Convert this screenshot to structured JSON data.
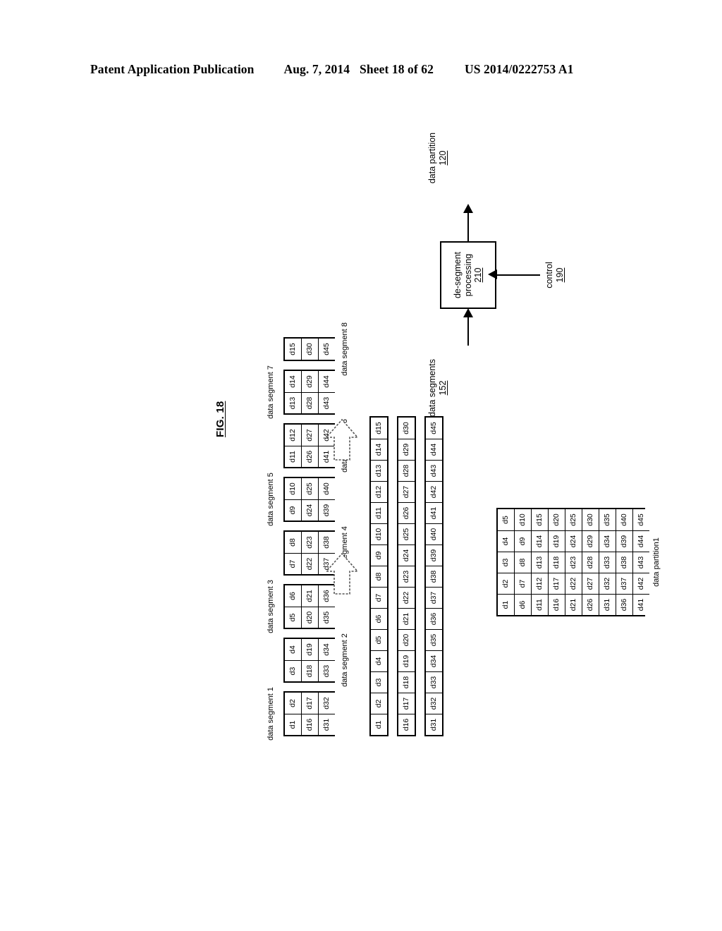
{
  "header": {
    "publication": "Patent Application Publication",
    "date": "Aug. 7, 2014",
    "sheet": "Sheet 18 of 62",
    "number": "US 2014/0222753 A1"
  },
  "figure": {
    "label": "FIG. 18"
  },
  "segments_group": {
    "segments": [
      {
        "label": "data segment 1",
        "label_side": "start",
        "rows": [
          [
            "d1",
            "d2"
          ],
          [
            "d16",
            "d17"
          ],
          [
            "d31",
            "d32"
          ]
        ]
      },
      {
        "label": "data segment 2",
        "label_side": "end",
        "rows": [
          [
            "d3",
            "d4"
          ],
          [
            "d18",
            "d19"
          ],
          [
            "d33",
            "d34"
          ]
        ]
      },
      {
        "label": "data segment 3",
        "label_side": "start",
        "rows": [
          [
            "d5",
            "d6"
          ],
          [
            "d20",
            "d21"
          ],
          [
            "d35",
            "d36"
          ]
        ]
      },
      {
        "label": "data segment 4",
        "label_side": "end",
        "rows": [
          [
            "d7",
            "d8"
          ],
          [
            "d22",
            "d23"
          ],
          [
            "d37",
            "d38"
          ]
        ]
      },
      {
        "label": "data segment 5",
        "label_side": "start",
        "rows": [
          [
            "d9",
            "d10"
          ],
          [
            "d24",
            "d25"
          ],
          [
            "d39",
            "d40"
          ]
        ]
      },
      {
        "label": "data segment 6",
        "label_side": "end",
        "rows": [
          [
            "d11",
            "d12"
          ],
          [
            "d26",
            "d27"
          ],
          [
            "d41",
            "d42"
          ]
        ]
      },
      {
        "label": "data segment 7",
        "label_side": "start",
        "rows": [
          [
            "d13",
            "d14"
          ],
          [
            "d28",
            "d29"
          ],
          [
            "d43",
            "d44"
          ]
        ]
      },
      {
        "label": "data segment 8",
        "label_side": "end",
        "rows": [
          [
            "d15"
          ],
          [
            "d30"
          ],
          [
            "d45"
          ]
        ]
      }
    ]
  },
  "strips_group": {
    "strips": [
      [
        "d1",
        "d2",
        "d3",
        "d4",
        "d5",
        "d6",
        "d7",
        "d8",
        "d9",
        "d10",
        "d11",
        "d12",
        "d13",
        "d14",
        "d15"
      ],
      [
        "d16",
        "d17",
        "d18",
        "d19",
        "d20",
        "d21",
        "d22",
        "d23",
        "d24",
        "d25",
        "d26",
        "d27",
        "d28",
        "d29",
        "d30"
      ],
      [
        "d31",
        "d32",
        "d33",
        "d34",
        "d35",
        "d36",
        "d37",
        "d38",
        "d39",
        "d40",
        "d41",
        "d42",
        "d43",
        "d44",
        "d45"
      ]
    ]
  },
  "partition": {
    "label": "data partition1",
    "rows": [
      [
        "d1",
        "d2",
        "d3",
        "d4",
        "d5"
      ],
      [
        "d6",
        "d7",
        "d8",
        "d9",
        "d10"
      ],
      [
        "d11",
        "d12",
        "d13",
        "d14",
        "d15"
      ],
      [
        "d16",
        "d17",
        "d18",
        "d19",
        "d20"
      ],
      [
        "d21",
        "d22",
        "d23",
        "d24",
        "d25"
      ],
      [
        "d26",
        "d27",
        "d28",
        "d29",
        "d30"
      ],
      [
        "d31",
        "d32",
        "d33",
        "d34",
        "d35"
      ],
      [
        "d36",
        "d37",
        "d38",
        "d39",
        "d40"
      ],
      [
        "d41",
        "d42",
        "d43",
        "d44",
        "d45"
      ]
    ]
  },
  "process_flow": {
    "input": {
      "text": "data segments",
      "ref": "152"
    },
    "box": {
      "line1": "de-segment",
      "line2": "processing",
      "ref": "210"
    },
    "output": {
      "text": "data partition",
      "ref": "120"
    },
    "control": {
      "text": "control",
      "ref": "190"
    }
  },
  "arrows": [
    {
      "name": "transform-arrow-1"
    },
    {
      "name": "transform-arrow-2"
    }
  ]
}
